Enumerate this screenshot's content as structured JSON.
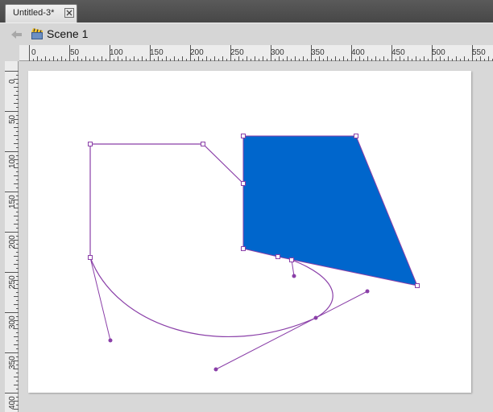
{
  "document": {
    "tab_title": "Untitled-3*"
  },
  "editbar": {
    "scene_name": "Scene 1"
  },
  "icons": {
    "back": "back-arrow-icon",
    "scene": "clapperboard-icon",
    "close": "close-icon"
  },
  "colors": {
    "fill": "#0066cc",
    "path": "#8a3fa8",
    "handle": "#8a3fa8",
    "stage": "#ffffff"
  },
  "ruler": {
    "horizontal_labels": [
      "0",
      "50",
      "100",
      "150",
      "200",
      "250",
      "300",
      "350",
      "400",
      "450",
      "500",
      "550"
    ],
    "vertical_labels": [
      "0",
      "50",
      "100",
      "150",
      "200",
      "250",
      "300",
      "350",
      "400"
    ]
  }
}
